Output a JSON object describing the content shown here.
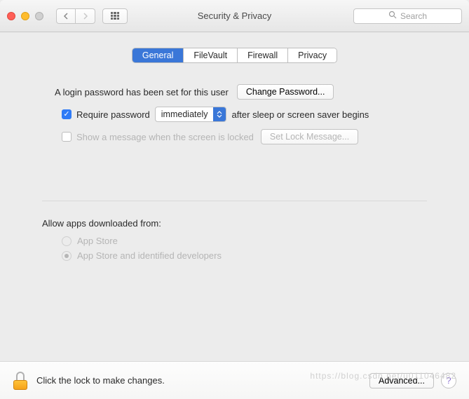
{
  "window": {
    "title": "Security & Privacy"
  },
  "search": {
    "placeholder": "Search"
  },
  "tabs": {
    "general": "General",
    "filevault": "FileVault",
    "firewall": "Firewall",
    "privacy": "Privacy"
  },
  "general": {
    "login_password_set_text": "A login password has been set for this user",
    "change_password_label": "Change Password...",
    "require_password_prefix": "Require password",
    "require_password_delay": "immediately",
    "require_password_suffix": "after sleep or screen saver begins",
    "show_lock_message_label": "Show a message when the screen is locked",
    "set_lock_message_label": "Set Lock Message...",
    "allow_apps_heading": "Allow apps downloaded from:",
    "radio_appstore": "App Store",
    "radio_appstore_identified": "App Store and identified developers"
  },
  "footer": {
    "lock_message": "Click the lock to make changes.",
    "advanced_label": "Advanced..."
  },
  "watermark": "https://blog.csdn.net/u011046482"
}
